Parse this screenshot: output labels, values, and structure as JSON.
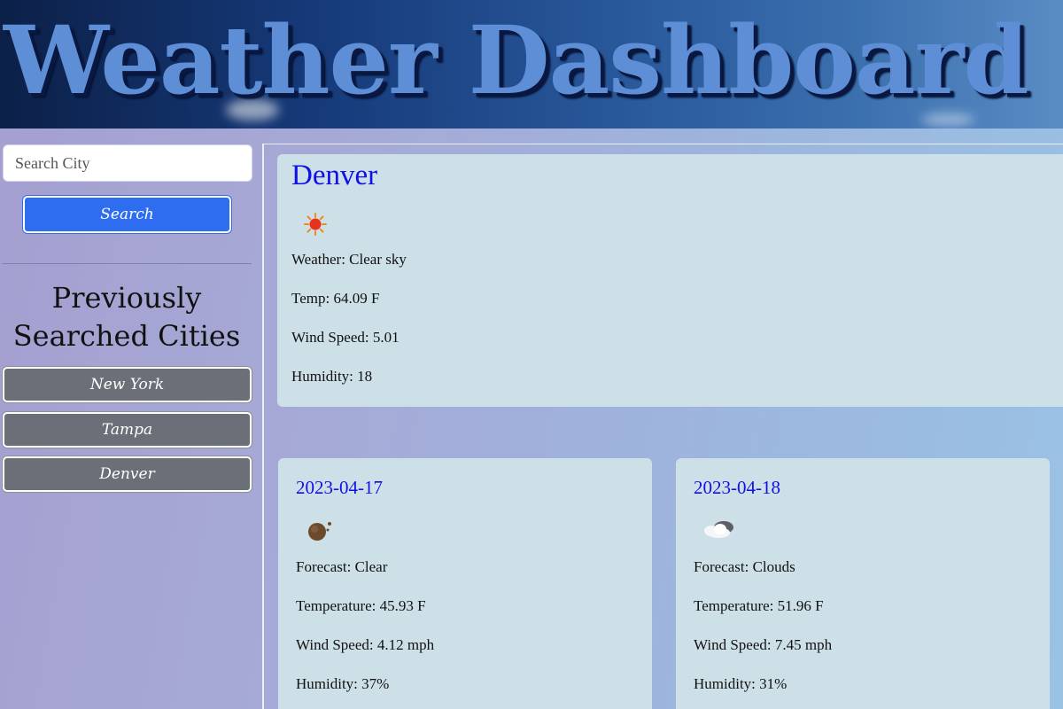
{
  "header": {
    "title": "Weather Dashboard"
  },
  "sidebar": {
    "search": {
      "placeholder": "Search City",
      "value": ""
    },
    "search_button_label": "Search",
    "history_title": "Previously Searched Cities",
    "history": [
      {
        "label": "New York"
      },
      {
        "label": "Tampa"
      },
      {
        "label": "Denver"
      }
    ]
  },
  "current": {
    "city": "Denver",
    "icon": "sun-icon",
    "weather": "Weather: Clear sky",
    "temp": "Temp: 64.09 F",
    "wind": "Wind Speed: 5.01",
    "humidity": "Humidity: 18"
  },
  "forecast": [
    {
      "date": "2023-04-17",
      "icon": "clear-night-icon",
      "forecast": "Forecast: Clear",
      "temperature": "Temperature: 45.93 F",
      "wind": "Wind Speed: 4.12 mph",
      "humidity": "Humidity: 37%"
    },
    {
      "date": "2023-04-18",
      "icon": "clouds-icon",
      "forecast": "Forecast: Clouds",
      "temperature": "Temperature: 51.96 F",
      "wind": "Wind Speed: 7.45 mph",
      "humidity": "Humidity: 31%"
    }
  ],
  "colors": {
    "accent": "#2f6df0",
    "city_text": "#1010e8",
    "card_bg": "#cde0e8",
    "history_button_bg": "#6b7078"
  }
}
